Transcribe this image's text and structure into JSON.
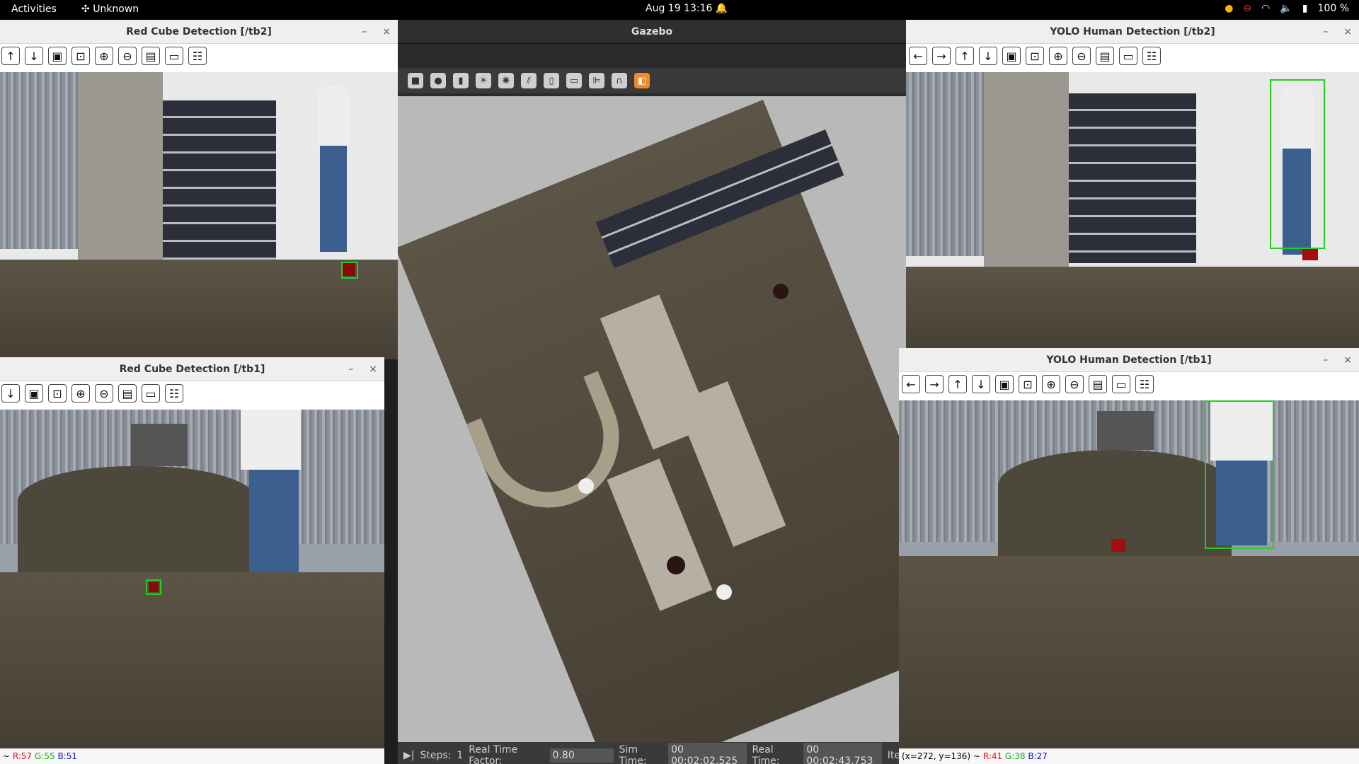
{
  "topbar": {
    "activities": "Activities",
    "app_name": "Unknown",
    "clock": "Aug 19  13:16",
    "battery": "100 %"
  },
  "windows": {
    "red_tb2": {
      "title": "Red Cube Detection [/tb2]"
    },
    "red_tb1": {
      "title": "Red Cube Detection [/tb1]",
      "status": {
        "prefix": "~",
        "r": "R:57",
        "g": "G:55",
        "b": "B:51"
      }
    },
    "gazebo": {
      "title": "Gazebo",
      "steps_label": "Steps:",
      "steps_value": "1",
      "rtf_label": "Real Time Factor:",
      "rtf_value": "0.80",
      "sim_label": "Sim Time:",
      "sim_value": "00 00:02:02.525",
      "real_label": "Real Time:",
      "real_value": "00 00:02:43.753",
      "iter_label": "Ite"
    },
    "yolo_tb2": {
      "title": "YOLO Human Detection [/tb2]"
    },
    "yolo_tb1": {
      "title": "YOLO Human Detection [/tb1]",
      "status": {
        "prefix": "(x=272, y=136) ~",
        "r": "R:41",
        "g": "G:38",
        "b": "B:27"
      }
    }
  },
  "window_controls": {
    "minimize": "–",
    "close": "×"
  },
  "icons": {
    "toolbar": [
      "arrow-left-icon",
      "arrow-right-icon",
      "arrow-up-icon",
      "arrow-down-icon",
      "zoom-fit-icon",
      "zoom-original-icon",
      "zoom-in-icon",
      "zoom-out-icon",
      "save-icon",
      "copy-icon",
      "properties-icon"
    ]
  }
}
